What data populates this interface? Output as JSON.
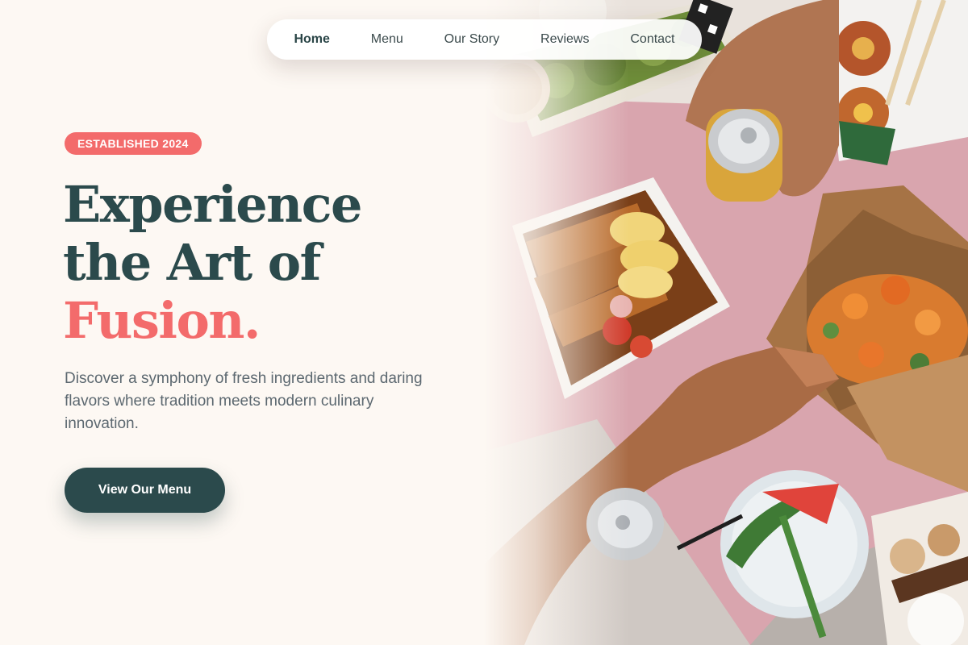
{
  "nav": {
    "items": [
      {
        "label": "Home",
        "active": true
      },
      {
        "label": "Menu",
        "active": false
      },
      {
        "label": "Our Story",
        "active": false
      },
      {
        "label": "Reviews",
        "active": false
      },
      {
        "label": "Contact",
        "active": false
      }
    ]
  },
  "hero": {
    "badge": "ESTABLISHED 2024",
    "headline_line1": "Experience",
    "headline_line2": "the Art of",
    "headline_accent": "Fusion.",
    "subtext": "Discover a symphony of fresh ingredients and daring flavors where tradition meets modern culinary innovation.",
    "cta_label": "View Our Menu"
  },
  "colors": {
    "background": "#fdf8f3",
    "primary": "#2b4a4c",
    "accent": "#f36b6b",
    "body_text": "#5c6870"
  }
}
